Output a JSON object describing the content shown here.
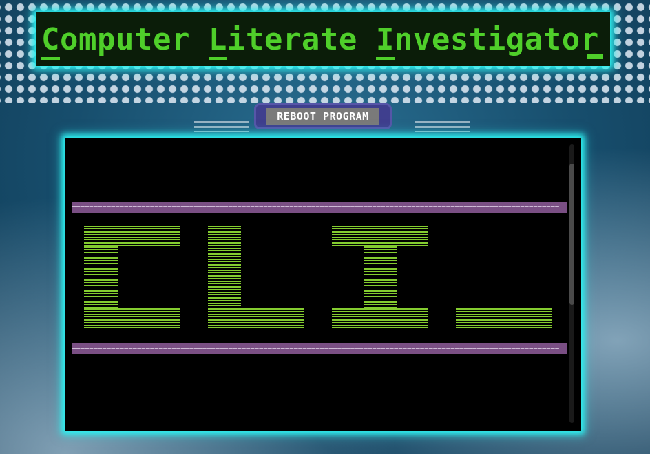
{
  "header": {
    "title_parts": [
      {
        "first": "C",
        "rest": "omputer "
      },
      {
        "first": "L",
        "rest": "iterate "
      },
      {
        "first": "I",
        "rest": "nvestigator "
      }
    ]
  },
  "toolbar": {
    "reboot_label": "REBOOT PROGRAM"
  },
  "terminal": {
    "divider_text": "================================================================================================================",
    "banner_text": "CLI_"
  },
  "colors": {
    "glow": "#2ef0f0",
    "title_green": "#4fcf2a",
    "ascii_green": "#84cc30",
    "divider_purple": "#7a4f84",
    "button_frame": "#3f3f8e",
    "button_gray": "#7a7a7a"
  }
}
